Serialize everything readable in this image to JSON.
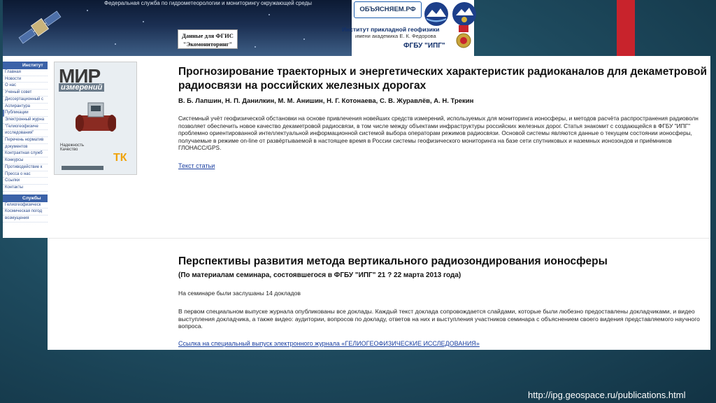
{
  "header": {
    "agency": "Федеральная служба по гидрометеорологии и мониторингу окружающей среды",
    "fgis_line1": "Данные для ФГИС",
    "fgis_line2": "\"Экомониторинг\"",
    "site_badge": "ОБЪЯСНЯЕМ.РФ",
    "institute": "Институт прикладной геофизики",
    "institute_sub": "имени академика Е. К. Федорова",
    "fgbu": "ФГБУ \"ИПГ\""
  },
  "sidebar": {
    "section1": "Институт",
    "items": [
      "Главная",
      "Новости",
      "О нас",
      "Ученый совет",
      "Диссертационный с",
      "Аспирантура",
      "Публикации",
      "Электронный журна",
      "\"Гелиогеофизиче",
      "исследования\"",
      "Перечень норматив",
      "документов",
      "Контрактная служб",
      "Конкурсы",
      "Противодействие к",
      "Пресса о нас",
      "Ссылки",
      "Контакты"
    ],
    "active_index": 6,
    "section2": "Службы",
    "items2": [
      "Гелиогеофизическ",
      "Космическая погод",
      "возмущения"
    ]
  },
  "cover": {
    "title": "МИР",
    "subtitle": "измерений",
    "caption": "Надежность",
    "caption2": "Качество",
    "logo": "ТК"
  },
  "article1": {
    "title": "Прогнозирование траекторных и энергетических характеристик радиоканалов для декаметровой радиосвязи на российских железных дорогах",
    "authors": "В. Б. Лапшин, Н. П. Данилкин, М. М. Анишин, Н. Г. Котонаева, С. В. Журавлёв, А. Н. Трекин",
    "abstract": "Системный учёт геофизической обстановки на основе привлечения новейших средств измерений, используемых для мониторинга ионосферы, и методов расчёта распространения радиоволн позволяет обеспечить новое качество декаметровой радиосвязи, в том числе между объектами инфраструктуры российских железных дорог. Статья знакомит с создающейся в ФГБУ \"ИПГ\" проблемно ориентированной интеллектуальной информационной системой выбора операторам режимов радиосвязи. Основой системы являются данные о текущем состоянии ионосферы, получаемые в режиме on-line от развёртываемой в настоящее время в России системы геофизического мониторинга на базе сети спутниковых и наземных ионозондов и приёмников ГЛОНАСС/GPS.",
    "link": "Текст статьи"
  },
  "article2": {
    "title": "Перспективы развития метода вертикального радиозондирования ионосферы",
    "subtitle": "(По материалам семинара, состоявшегося в ФГБУ \"ИПГ\" 21 ? 22 марта 2013 года)",
    "heard": "На семинаре были заслушаны 14 докладов",
    "text": "В первом специальном выпуске журнала опубликованы все доклады. Каждый текст доклада сопровождается слайдами, которые были любезно предоставлены докладчиками, и видео выступления докладчика, а также видео: аудитории, вопросов по докладу, ответов на них и выступления участников семинара с объяснением своего видения представляемого научного вопроса.",
    "link": "Ссылка на специальный выпуск электронного журнала «ГЕЛИОГЕОФИЗИЧЕСКИЕ ИССЛЕДОВАНИЯ»"
  },
  "footer": {
    "url": "http://ipg.geospace.ru/publications.html"
  },
  "colors": {
    "accent_red": "#c8232c",
    "link": "#1a3fa0",
    "sidebar_head": "#3b62a8"
  }
}
